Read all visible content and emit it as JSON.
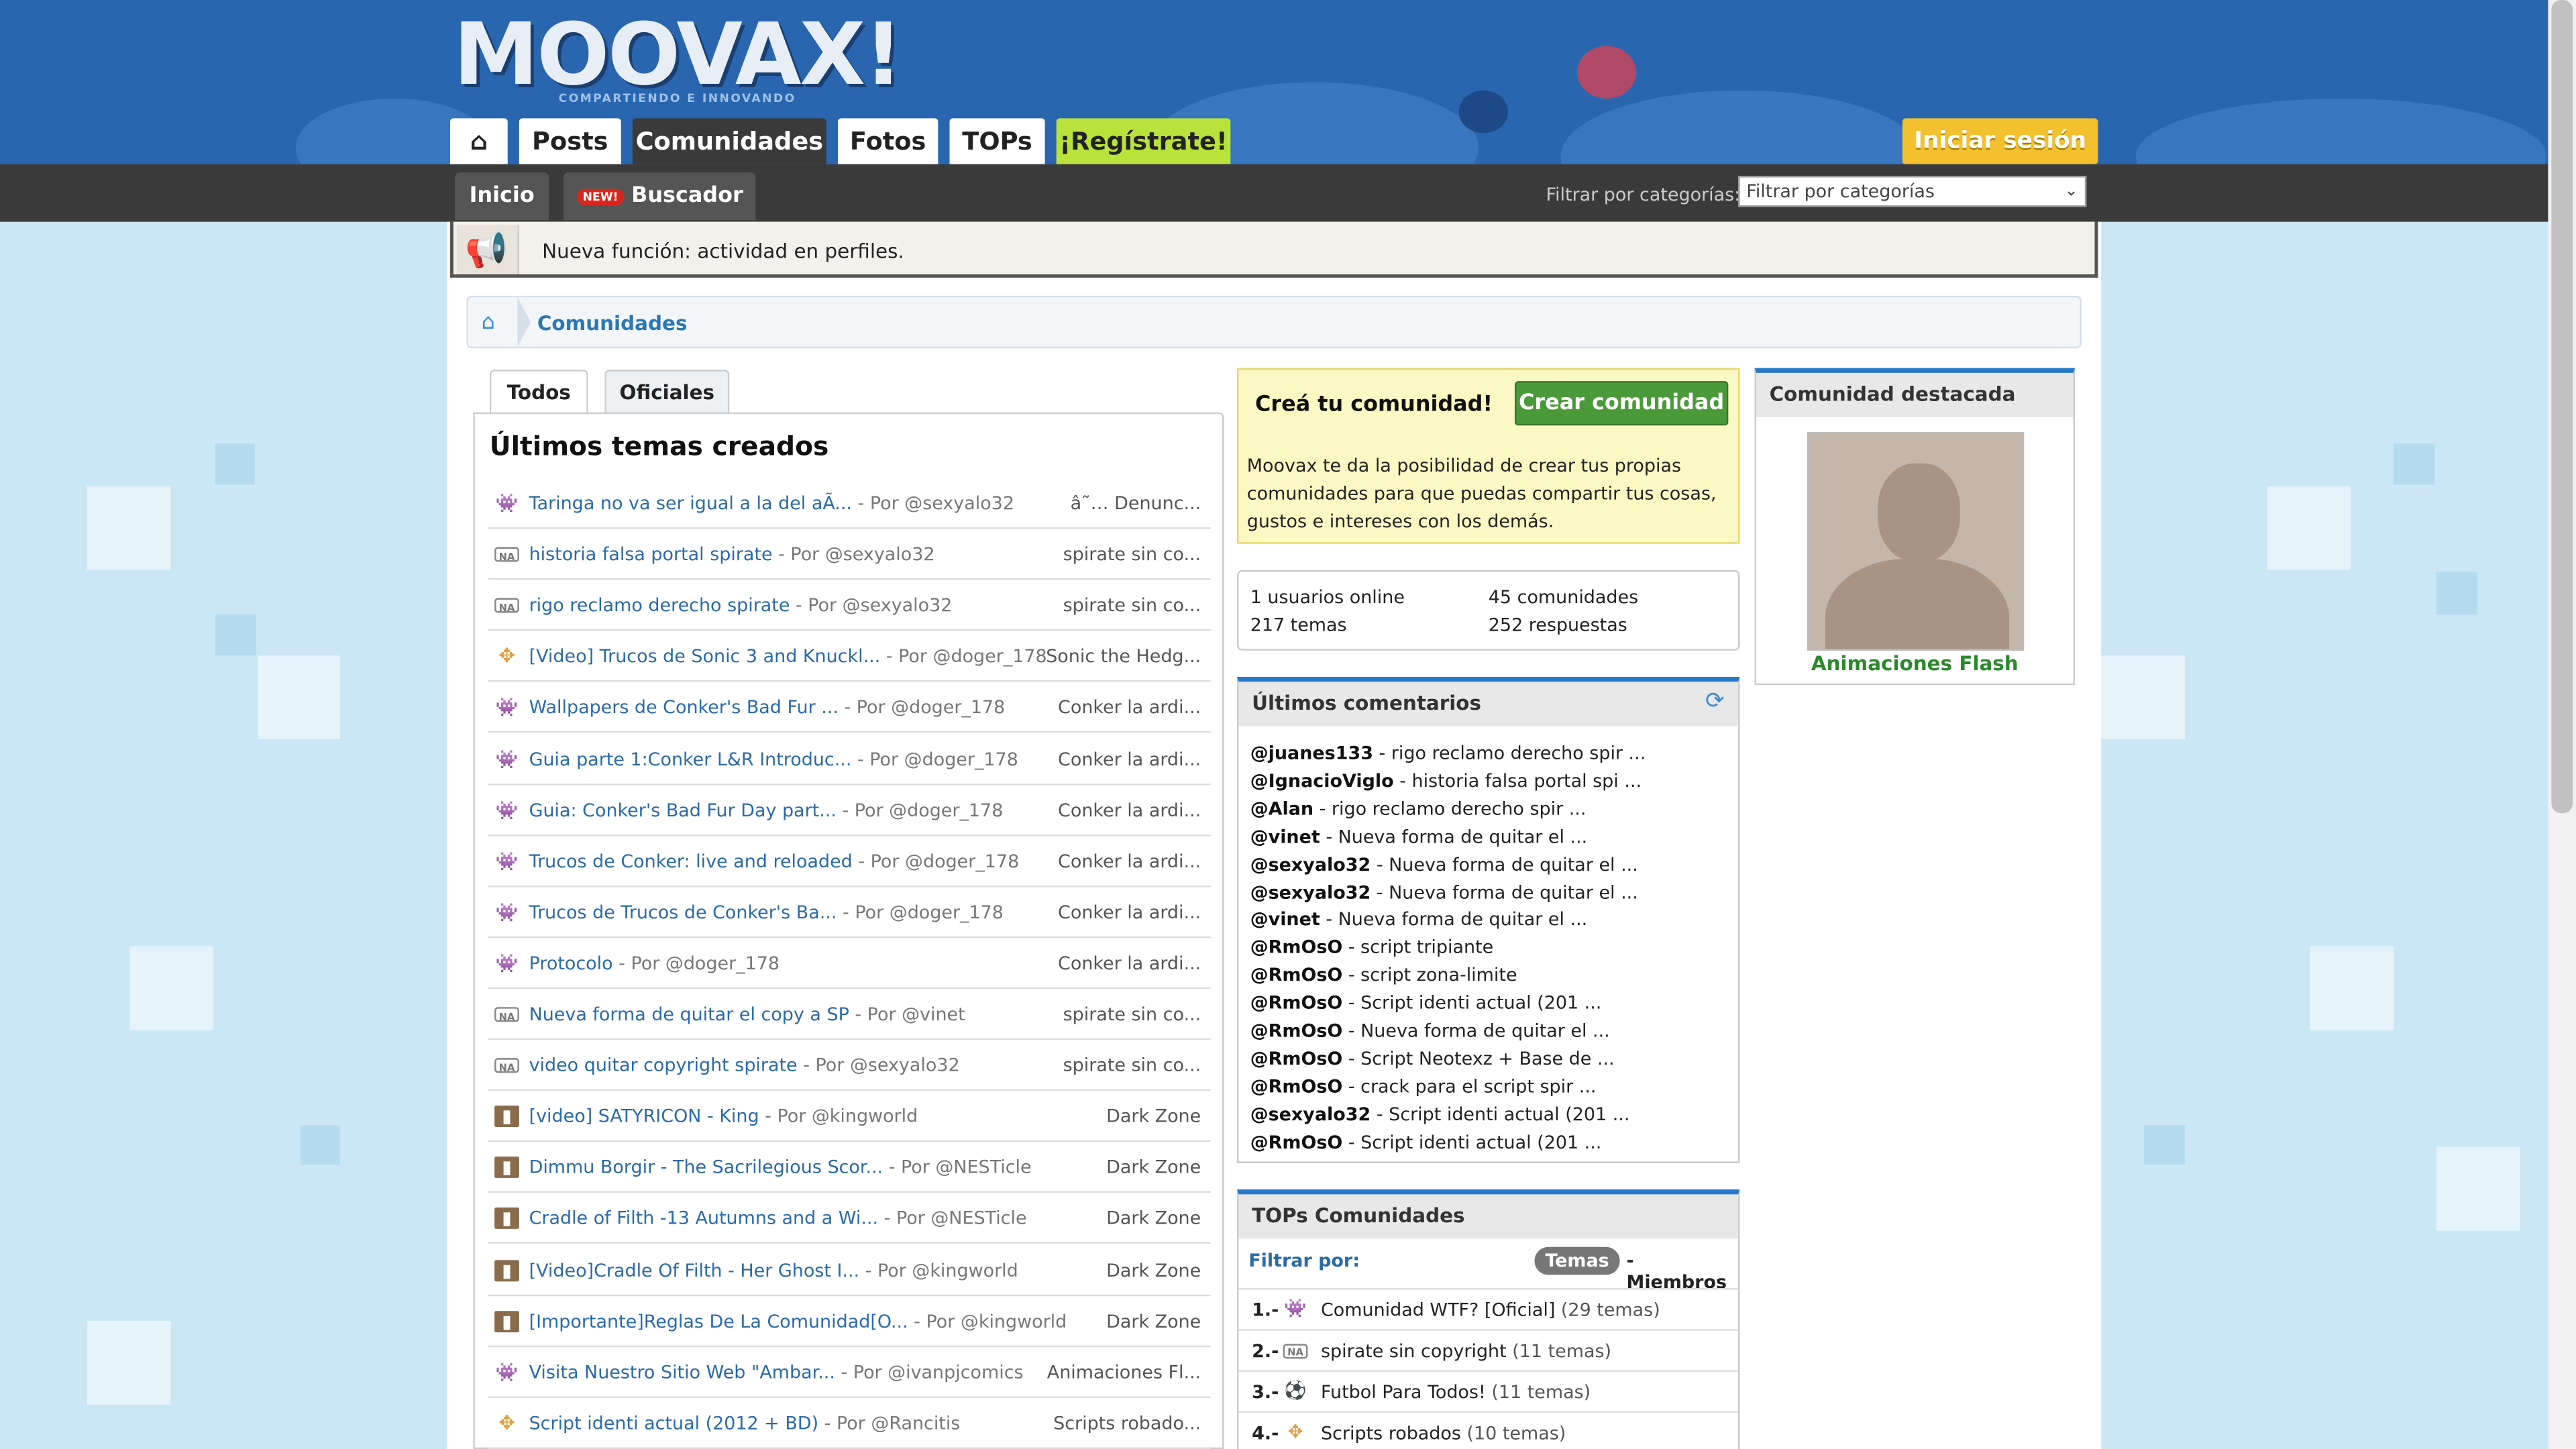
{
  "header": {
    "logo_text": "MOOVAX!",
    "logo_tagline": "COMPARTIENDO E INNOVANDO",
    "nav_tabs": [
      "Posts",
      "Comunidades",
      "Fotos",
      "TOPs",
      "¡Regístrate!"
    ],
    "home_icon": "home-icon",
    "login_label": "Iniciar sesión"
  },
  "subnav": {
    "tabs": [
      "Inicio",
      "Buscador"
    ],
    "new_badge": "NEW!",
    "filter_label": "Filtrar por categorías:",
    "filter_selected": "Filtrar por categorías"
  },
  "notice": {
    "text": "Nueva función: actividad en perfiles.",
    "icon": "megaphone-icon"
  },
  "breadcrumb": {
    "items": [
      "Comunidades"
    ]
  },
  "tabs": [
    "Todos",
    "Oficiales"
  ],
  "topics": {
    "title": "Últimos temas creados",
    "rows": [
      {
        "icon": "invader",
        "title": "Taringa no va ser igual a la del aÃ...",
        "by": " - Por @sexyalo32",
        "community": "â˜… Denunc..."
      },
      {
        "icon": "na",
        "title": "historia falsa portal spirate",
        "by": " - Por @sexyalo32",
        "community": "spirate sin co..."
      },
      {
        "icon": "na",
        "title": "rigo reclamo derecho spirate",
        "by": " - Por @sexyalo32",
        "community": "spirate sin co..."
      },
      {
        "icon": "sign",
        "title": "[Video] Trucos de Sonic 3 and Knuckl...",
        "by": " - Por @doger_178",
        "community": "Sonic the Hedg..."
      },
      {
        "icon": "invader",
        "title": "Wallpapers de Conker's Bad Fur ...",
        "by": " - Por @doger_178",
        "community": "Conker la ardi..."
      },
      {
        "icon": "invader",
        "title": "Guia parte 1:Conker L&R Introduc...",
        "by": " - Por @doger_178",
        "community": "Conker la ardi..."
      },
      {
        "icon": "invader",
        "title": "Guia: Conker's Bad Fur Day part...",
        "by": " - Por @doger_178",
        "community": "Conker la ardi..."
      },
      {
        "icon": "invader",
        "title": "Trucos de Conker: live and reloaded",
        "by": " - Por @doger_178",
        "community": "Conker la ardi..."
      },
      {
        "icon": "invader",
        "title": "Trucos de Trucos de Conker's Ba...",
        "by": " - Por @doger_178",
        "community": "Conker la ardi..."
      },
      {
        "icon": "invader",
        "title": "Protocolo",
        "by": " - Por @doger_178",
        "community": "Conker la ardi..."
      },
      {
        "icon": "na",
        "title": "Nueva forma de quitar el copy a SP",
        "by": " - Por @vinet",
        "community": "spirate sin co..."
      },
      {
        "icon": "na",
        "title": "video quitar copyright spirate",
        "by": " - Por @sexyalo32",
        "community": "spirate sin co..."
      },
      {
        "icon": "book",
        "title": "[video] SATYRICON - King",
        "by": " - Por @kingworld",
        "community": "Dark Zone"
      },
      {
        "icon": "book",
        "title": "Dimmu Borgir - The Sacrilegious Scor...",
        "by": " - Por @NESTicle",
        "community": "Dark Zone"
      },
      {
        "icon": "book",
        "title": "Cradle of Filth -13 Autumns and a Wi...",
        "by": " - Por @NESTicle",
        "community": "Dark Zone"
      },
      {
        "icon": "book",
        "title": "[Video]Cradle Of Filth - Her Ghost I...",
        "by": " - Por @kingworld",
        "community": "Dark Zone"
      },
      {
        "icon": "book",
        "title": "[Importante]Reglas De La Comunidad[O...",
        "by": " - Por @kingworld",
        "community": "Dark Zone"
      },
      {
        "icon": "invader",
        "title": "Visita Nuestro Sitio Web \"Ambar...",
        "by": " - Por @ivanpjcomics",
        "community": "Animaciones Fl..."
      },
      {
        "icon": "sign",
        "title": "Script identi actual (2012 + BD)",
        "by": " - Por @Rancitis",
        "community": "Scripts robado..."
      }
    ]
  },
  "create": {
    "heading": "Creá tu comunidad!",
    "button": "Crear comunidad",
    "description": "Moovax te da la posibilidad de crear tus propias comunidades para que puedas compartir tus cosas, gustos e intereses con los demás."
  },
  "stats": {
    "online": "1 usuarios online",
    "communities": "45 comunidades",
    "topics": "217 temas",
    "replies": "252 respuestas"
  },
  "comments": {
    "title": "Últimos comentarios",
    "items": [
      {
        "user": "@juanes133",
        "text": " - rigo reclamo derecho spir ..."
      },
      {
        "user": "@IgnacioViglo",
        "text": " - historia falsa portal spi ..."
      },
      {
        "user": "@Alan",
        "text": " - rigo reclamo derecho spir ..."
      },
      {
        "user": "@vinet",
        "text": " - Nueva forma de quitar el ..."
      },
      {
        "user": "@sexyalo32",
        "text": " - Nueva forma de quitar el ..."
      },
      {
        "user": "@sexyalo32",
        "text": " - Nueva forma de quitar el ..."
      },
      {
        "user": "@vinet",
        "text": " - Nueva forma de quitar el ..."
      },
      {
        "user": "@RmOsO",
        "text": " - script tripiante"
      },
      {
        "user": "@RmOsO",
        "text": " - script zona-limite"
      },
      {
        "user": "@RmOsO",
        "text": " - Script identi actual (201 ..."
      },
      {
        "user": "@RmOsO",
        "text": " - Nueva forma de quitar el ..."
      },
      {
        "user": "@RmOsO",
        "text": " - Script Neotexz + Base de ..."
      },
      {
        "user": "@RmOsO",
        "text": " - crack para el script spir ..."
      },
      {
        "user": "@sexyalo32",
        "text": " - Script identi actual (201 ..."
      },
      {
        "user": "@RmOsO",
        "text": " - Script identi actual (201 ..."
      }
    ]
  },
  "tops": {
    "title": "TOPs Comunidades",
    "filter_label": "Filtrar por:",
    "filter_active": "Temas",
    "filter_other": "- Miembros",
    "items": [
      {
        "rank": "1.-",
        "icon": "invader",
        "name": "Comunidad WTF? [Oficial]",
        "count": " (29 temas)"
      },
      {
        "rank": "2.-",
        "icon": "na",
        "name": "spirate sin copyright",
        "count": " (11 temas)"
      },
      {
        "rank": "3.-",
        "icon": "ball",
        "name": "Futbol Para Todos!",
        "count": " (11 temas)"
      },
      {
        "rank": "4.-",
        "icon": "sign",
        "name": "Scripts robados",
        "count": " (10 temas)"
      }
    ]
  },
  "featured": {
    "title": "Comunidad destacada",
    "name": "Animaciones Flash"
  },
  "colors": {
    "header_blue": "#2a66b0",
    "dark_bar": "#3a3a3a",
    "register_green": "#b9e33a",
    "login_yellow": "#f2c12d",
    "link_blue": "#2a6aa8",
    "panel_accent": "#2a78c8",
    "create_green": "#4b9a3a"
  }
}
